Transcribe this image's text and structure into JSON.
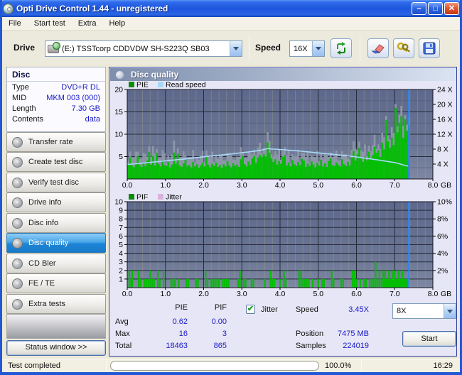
{
  "window": {
    "title": "Opti Drive Control 1.44 - unregistered"
  },
  "menu": {
    "items": [
      {
        "label": "File"
      },
      {
        "label": "Start test"
      },
      {
        "label": "Extra"
      },
      {
        "label": "Help"
      }
    ]
  },
  "toolbar": {
    "drive_label": "Drive",
    "drive_value": "(E:)   TSSTcorp CDDVDW SH-S223Q SB03",
    "speed_label": "Speed",
    "speed_value": "16X",
    "icons": [
      "cd-drive-icon",
      "refresh-arrows-icon",
      "eraser-icon",
      "keys-icon",
      "save-disk-icon"
    ]
  },
  "disc_panel": {
    "title": "Disc",
    "rows": [
      {
        "label": "Type",
        "value": "DVD+R DL"
      },
      {
        "label": "MID",
        "value": "MKM 003 (000)"
      },
      {
        "label": "Length",
        "value": "7.30 GB"
      },
      {
        "label": "Contents",
        "value": "data"
      }
    ]
  },
  "sidebar": {
    "selected_index": 5,
    "items": [
      {
        "label": "Transfer rate"
      },
      {
        "label": "Create test disc"
      },
      {
        "label": "Verify test disc"
      },
      {
        "label": "Drive info"
      },
      {
        "label": "Disc info"
      },
      {
        "label": "Disc quality"
      },
      {
        "label": "CD Bler"
      },
      {
        "label": "FE / TE"
      },
      {
        "label": "Extra tests"
      }
    ],
    "status_button": "Status window >>"
  },
  "main": {
    "header": "Disc quality"
  },
  "stats": {
    "col_pie": "PIE",
    "col_pif": "PIF",
    "rows": [
      {
        "label": "Avg",
        "pie": "0.62",
        "pif": "0.00"
      },
      {
        "label": "Max",
        "pie": "16",
        "pif": "3"
      },
      {
        "label": "Total",
        "pie": "18463",
        "pif": "865"
      }
    ],
    "jitter": {
      "label": "Jitter",
      "checked": true,
      "checkmark": "✔"
    },
    "speed": {
      "label": "Speed",
      "value": "3.45X"
    },
    "position": {
      "label": "Position",
      "value": "7475 MB"
    },
    "samples": {
      "label": "Samples",
      "value": "224019"
    },
    "speed_select": "8X",
    "start_button": "Start"
  },
  "statusbar": {
    "status": "Test completed",
    "progress_percent": "100.0%",
    "time": "16:29"
  },
  "chart_data": [
    {
      "type": "bar",
      "name": "pie-readspeed-chart",
      "legend": [
        {
          "name": "PIE",
          "color": "#0a8c0a"
        },
        {
          "name": "Read speed",
          "color": "#a6d9f7"
        }
      ],
      "x_unit": "GB",
      "xlim": [
        0,
        8
      ],
      "x_ticks": [
        0,
        1,
        2,
        3,
        4,
        5,
        6,
        7,
        8
      ],
      "left_axis": {
        "label": "PIE",
        "lim": [
          0,
          20
        ],
        "ticks": [
          5,
          10,
          15,
          20
        ]
      },
      "right_axis": {
        "label": "Read speed",
        "lim": [
          0,
          24
        ],
        "ticks": [
          4,
          8,
          12,
          16,
          20,
          24
        ],
        "suffix": " X"
      },
      "grid": {
        "v_minor": 0.2,
        "v_major": 1,
        "h_minor": 2.5,
        "h_major": 5
      },
      "bin_width_gb": 0.05,
      "values": [
        3.2,
        4.8,
        3.0,
        2.6,
        3.4,
        5.2,
        3.1,
        2.7,
        3.6,
        2.9,
        4.1,
        6.0,
        3.2,
        5.1,
        3.0,
        5.8,
        3.3,
        2.8,
        4.2,
        3.1,
        2.9,
        3.8,
        2.6,
        3.2,
        5.9,
        3.4,
        5.6,
        3.0,
        2.7,
        3.5,
        4.3,
        2.9,
        3.1,
        2.6,
        3.8,
        2.8,
        3.3,
        2.5,
        3.0,
        3.6,
        2.8,
        5.0,
        3.2,
        2.6,
        3.4,
        2.9,
        3.7,
        2.7,
        3.1,
        2.5,
        3.3,
        2.8,
        4.0,
        3.0,
        2.6,
        3.5,
        2.9,
        3.2,
        2.7,
        4.4,
        5.1,
        3.3,
        2.8,
        3.9,
        3.1,
        4.6,
        5.2,
        3.6,
        4.8,
        5.4,
        4.9,
        5.6,
        5.0,
        8.2,
        5.8,
        4.6,
        3.8,
        4.4,
        3.2,
        4.0,
        3.4,
        4.9,
        5.3,
        3.0,
        3.7,
        2.8,
        4.2,
        3.3,
        2.9,
        3.8,
        3.1,
        4.5,
        4.1,
        2.7,
        3.4,
        2.9,
        3.9,
        3.2,
        2.6,
        3.6,
        3.0,
        4.3,
        2.8,
        3.5,
        2.7,
        4.0,
        4.6,
        3.1,
        2.9,
        3.7,
        3.2,
        2.8,
        4.4,
        3.3,
        2.9,
        3.8,
        3.0,
        4.7,
        6.2,
        4.1,
        5.5,
        7.0,
        4.6,
        3.8,
        5.0,
        4.2,
        6.1,
        4.4,
        5.3,
        7.2,
        5.8,
        6.4,
        4.9,
        8.1,
        6.6,
        13.2,
        8.4,
        7.0,
        9.3,
        7.6,
        15.9,
        10.4,
        12.6,
        14.1,
        9.2,
        13.4,
        10.8,
        12.0
      ],
      "read_speed_points": [
        [
          0,
          3.9
        ],
        [
          0.25,
          4.1
        ],
        [
          0.5,
          4.35
        ],
        [
          0.75,
          4.6
        ],
        [
          1,
          4.85
        ],
        [
          1.25,
          5.1
        ],
        [
          1.5,
          5.35
        ],
        [
          1.75,
          5.65
        ],
        [
          2,
          5.95
        ],
        [
          2.25,
          6.2
        ],
        [
          2.5,
          6.45
        ],
        [
          2.75,
          6.75
        ],
        [
          3,
          7.05
        ],
        [
          3.25,
          7.35
        ],
        [
          3.5,
          7.7
        ],
        [
          3.65,
          8.1
        ],
        [
          3.7,
          8.2
        ],
        [
          3.75,
          8.05
        ],
        [
          4,
          7.9
        ],
        [
          4.25,
          7.7
        ],
        [
          4.5,
          7.5
        ],
        [
          4.75,
          7.25
        ],
        [
          5,
          7.0
        ],
        [
          5.25,
          6.75
        ],
        [
          5.5,
          6.5
        ],
        [
          5.75,
          6.2
        ],
        [
          6,
          5.9
        ],
        [
          6.25,
          5.55
        ],
        [
          6.5,
          5.2
        ],
        [
          6.75,
          4.8
        ],
        [
          7,
          4.4
        ],
        [
          7.15,
          4.0
        ],
        [
          7.25,
          3.7
        ],
        [
          7.35,
          3.45
        ]
      ],
      "cursor_gb": 7.37
    },
    {
      "type": "bar",
      "name": "pif-jitter-chart",
      "legend": [
        {
          "name": "PIF",
          "color": "#0a8c0a"
        },
        {
          "name": "Jitter",
          "color": "#d9b3dc"
        }
      ],
      "x_unit": "GB",
      "xlim": [
        0,
        8
      ],
      "x_ticks": [
        0,
        1,
        2,
        3,
        4,
        5,
        6,
        7,
        8
      ],
      "left_axis": {
        "label": "PIF",
        "lim": [
          0,
          10
        ],
        "ticks": [
          1,
          2,
          3,
          4,
          5,
          6,
          7,
          8,
          9,
          10
        ]
      },
      "right_axis": {
        "label": "Jitter",
        "lim": [
          0,
          10
        ],
        "ticks": [
          2,
          4,
          6,
          8,
          10
        ],
        "suffix": "%"
      },
      "grid": {
        "v_minor": 0.2,
        "v_major": 1,
        "h_minor": 1,
        "h_major": 1
      },
      "spikes": [
        [
          0.05,
          2
        ],
        [
          0.1,
          1
        ],
        [
          0.13,
          2
        ],
        [
          0.3,
          2
        ],
        [
          0.35,
          1
        ],
        [
          0.45,
          1
        ],
        [
          0.5,
          1
        ],
        [
          0.55,
          1
        ],
        [
          0.6,
          2
        ],
        [
          0.65,
          1
        ],
        [
          0.7,
          1
        ],
        [
          0.8,
          2
        ],
        [
          0.85,
          1
        ],
        [
          0.95,
          2
        ],
        [
          1.15,
          1
        ],
        [
          1.2,
          1
        ],
        [
          1.25,
          1
        ],
        [
          1.35,
          1
        ],
        [
          1.55,
          1
        ],
        [
          1.6,
          1
        ],
        [
          1.8,
          1
        ],
        [
          1.85,
          1
        ],
        [
          2.05,
          2
        ],
        [
          2.1,
          1
        ],
        [
          2.2,
          1
        ],
        [
          2.25,
          1
        ],
        [
          2.3,
          1
        ],
        [
          2.35,
          1
        ],
        [
          2.4,
          1
        ],
        [
          2.5,
          1
        ],
        [
          2.55,
          1
        ],
        [
          2.6,
          1
        ],
        [
          2.65,
          1
        ],
        [
          2.9,
          1
        ],
        [
          2.95,
          2
        ],
        [
          3.05,
          1
        ],
        [
          3.1,
          1
        ],
        [
          3.25,
          1
        ],
        [
          3.3,
          1
        ],
        [
          3.6,
          1
        ],
        [
          3.75,
          2
        ],
        [
          3.8,
          1
        ],
        [
          3.85,
          1
        ],
        [
          4.0,
          1
        ],
        [
          4.1,
          2
        ],
        [
          4.15,
          1
        ],
        [
          4.5,
          2
        ],
        [
          4.55,
          2
        ],
        [
          4.6,
          1
        ],
        [
          4.65,
          1
        ],
        [
          4.7,
          1
        ],
        [
          4.75,
          1
        ],
        [
          4.85,
          1
        ],
        [
          5.0,
          1
        ],
        [
          5.1,
          1
        ],
        [
          5.15,
          1
        ],
        [
          5.35,
          2
        ],
        [
          5.4,
          1
        ],
        [
          5.6,
          1
        ],
        [
          5.65,
          1
        ],
        [
          5.9,
          2
        ],
        [
          5.95,
          2
        ],
        [
          6.0,
          1
        ],
        [
          6.1,
          1
        ],
        [
          6.2,
          1
        ],
        [
          6.25,
          1
        ],
        [
          6.35,
          1
        ],
        [
          6.4,
          1
        ],
        [
          6.45,
          1
        ],
        [
          6.5,
          3
        ],
        [
          6.55,
          1
        ],
        [
          6.6,
          2
        ],
        [
          6.65,
          1
        ],
        [
          6.7,
          2
        ],
        [
          6.72,
          1
        ],
        [
          6.75,
          2
        ],
        [
          6.77,
          1
        ],
        [
          6.8,
          1
        ],
        [
          6.82,
          1
        ],
        [
          6.85,
          2
        ],
        [
          6.87,
          1
        ],
        [
          6.9,
          1
        ],
        [
          6.92,
          1
        ],
        [
          6.95,
          2
        ],
        [
          6.97,
          1
        ],
        [
          7.0,
          2
        ],
        [
          7.02,
          1
        ],
        [
          7.05,
          1
        ],
        [
          7.07,
          1
        ],
        [
          7.1,
          2
        ],
        [
          7.12,
          1
        ],
        [
          7.15,
          1
        ],
        [
          7.17,
          1
        ],
        [
          7.2,
          2
        ],
        [
          7.22,
          1
        ],
        [
          7.25,
          1
        ],
        [
          7.27,
          1
        ],
        [
          7.3,
          1
        ],
        [
          7.32,
          1
        ],
        [
          7.35,
          1
        ]
      ],
      "cursor_gb": 7.37
    }
  ]
}
